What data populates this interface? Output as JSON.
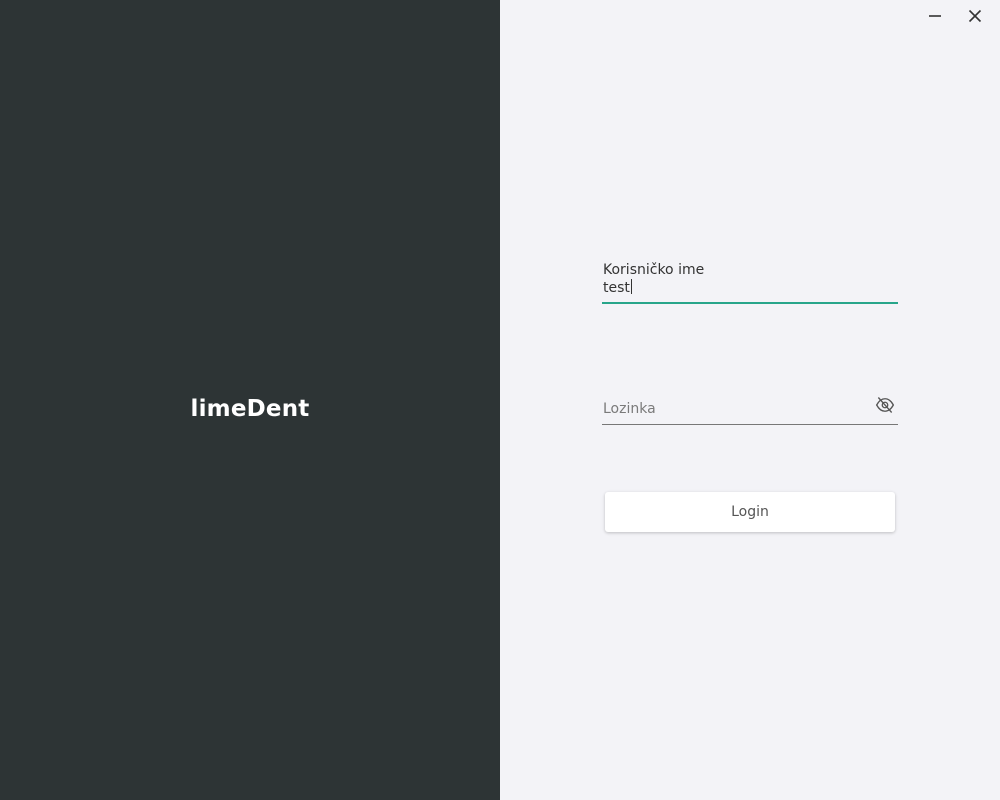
{
  "brand": {
    "name": "limeDent"
  },
  "window_controls": {
    "minimize_icon": "minimize-icon",
    "close_icon": "close-icon"
  },
  "login_form": {
    "username": {
      "label": "Korisničko ime",
      "value": "test"
    },
    "password": {
      "placeholder": "Lozinka",
      "visibility_icon": "eye-off-icon"
    },
    "submit_label": "Login"
  },
  "colors": {
    "left_panel_bg": "#2d3435",
    "right_panel_bg": "#f3f3f7",
    "accent": "#27a58a"
  }
}
